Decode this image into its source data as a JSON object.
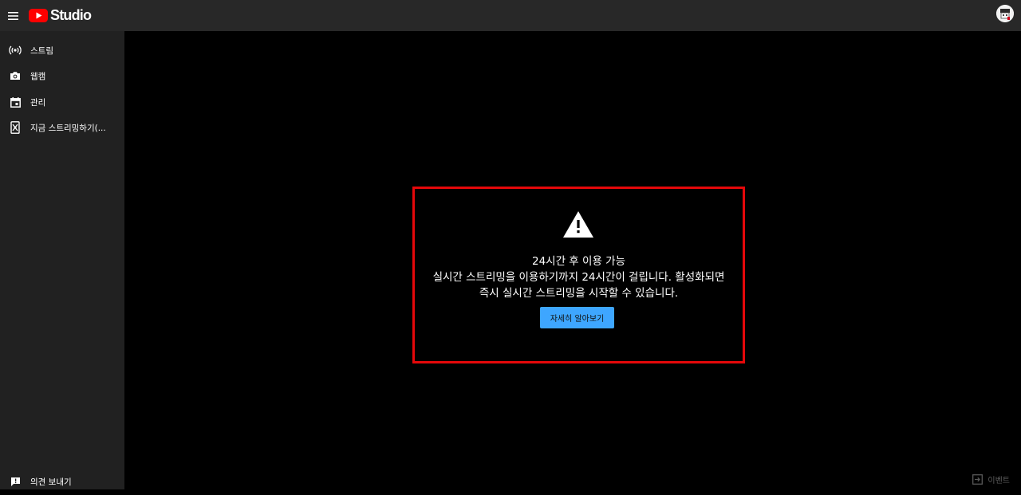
{
  "header": {
    "logo_text": "Studio",
    "menu_icon": "hamburger-icon",
    "brand_color": "#ff0000"
  },
  "sidebar": {
    "items": [
      {
        "label": "스트림",
        "icon": "broadcast-icon"
      },
      {
        "label": "웹캠",
        "icon": "camera-icon"
      },
      {
        "label": "관리",
        "icon": "calendar-icon"
      },
      {
        "label": "지금 스트리밍하기(...",
        "icon": "mobile-stream-icon"
      }
    ],
    "feedback_label": "의견 보내기"
  },
  "alert": {
    "title": "24시간 후 이용 가능",
    "description": "실시간 스트리밍을 이용하기까지 24시간이 걸립니다. 활성화되면 즉시 실시간 스트리밍을 시작할 수 있습니다.",
    "button_label": "자세히 알아보기",
    "border_color": "#e5080a",
    "button_color": "#3ea6ff"
  },
  "footer": {
    "events_label": "이벤트"
  }
}
